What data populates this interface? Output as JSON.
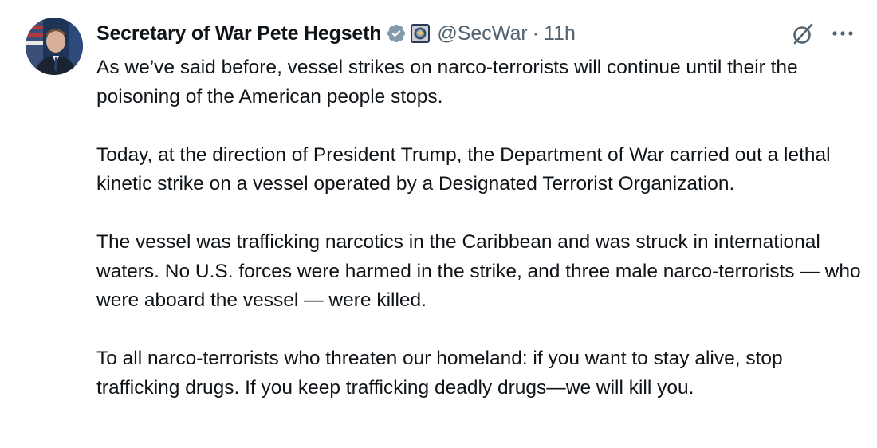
{
  "tweet": {
    "author": {
      "display_name": "Secretary of War Pete Hegseth",
      "handle": "@SecWar",
      "verified_badge_icon": "verified-badge-icon",
      "affiliate_badge_icon": "department-seal-icon",
      "avatar_icon": "profile-avatar"
    },
    "separator": "·",
    "time": "11h",
    "actions": {
      "grok_icon": "grok-icon",
      "more_icon": "more-options-icon"
    },
    "paragraphs": [
      "As we’ve said before, vessel strikes on narco-terrorists will continue until their the poisoning of the American people stops.",
      "Today, at the direction of President Trump, the Department of War carried out a lethal kinetic strike on a vessel operated by a Designated Terrorist Organization.",
      "The vessel was trafficking narcotics in the Caribbean and was struck in international waters. No U.S. forces were harmed in the strike, and three male narco-terrorists — who were aboard the vessel — were killed.",
      "To all narco-terrorists who threaten our homeland: if you want to stay alive, stop trafficking drugs. If you keep trafficking deadly drugs—we will kill you."
    ]
  },
  "colors": {
    "text_primary": "#0f1419",
    "text_secondary": "#536471",
    "verified_blue": "#829aab",
    "background": "#ffffff"
  }
}
